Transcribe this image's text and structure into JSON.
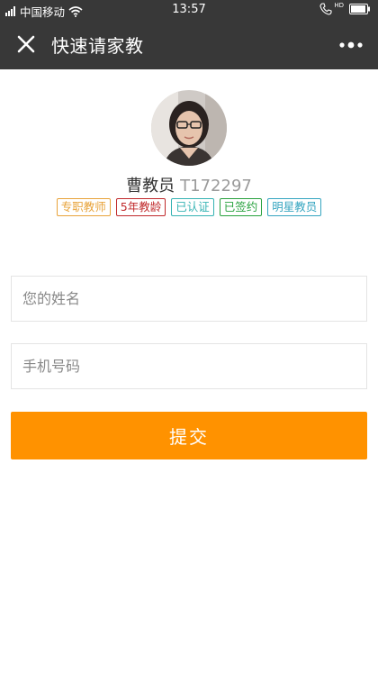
{
  "status_bar": {
    "carrier": "中国移动",
    "time": "13:57",
    "hd_label": "HD"
  },
  "nav": {
    "title": "快速请家教"
  },
  "teacher": {
    "name": "曹教员",
    "id": "T172297"
  },
  "tags": [
    {
      "label": "专职教师",
      "color": "#e8a33a"
    },
    {
      "label": "5年教龄",
      "color": "#c0292b"
    },
    {
      "label": "已认证",
      "color": "#35b3b3"
    },
    {
      "label": "已签约",
      "color": "#27a13d"
    },
    {
      "label": "明星教员",
      "color": "#35a5c0"
    }
  ],
  "form": {
    "name_placeholder": "您的姓名",
    "phone_placeholder": "手机号码",
    "submit_label": "提交"
  },
  "colors": {
    "header_bg": "#383838",
    "submit_bg": "#ff9200"
  },
  "icons": {
    "close": "close-icon",
    "more": "more-icon",
    "wifi": "wifi-icon",
    "signal": "signal-icon",
    "call": "call-icon",
    "battery": "battery-icon"
  }
}
